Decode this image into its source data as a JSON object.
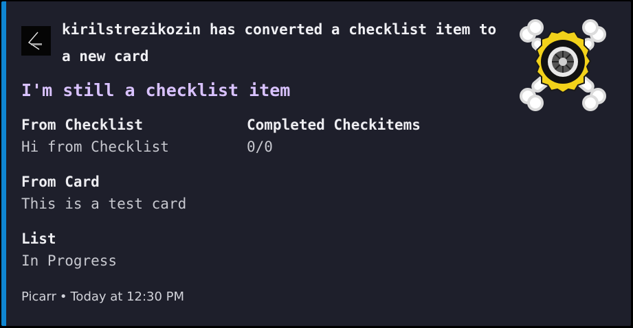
{
  "embed": {
    "accent_color": "#0f86d2",
    "author": {
      "avatar_icon": "kirilstrezikozin-avatar",
      "text": "kirilstrezikozin has converted a checklist item to a new card"
    },
    "title": "I'm still a checklist item",
    "thumbnail_icon": "gear-crossbones-logo",
    "fields": [
      {
        "name": "From Checklist",
        "value": "Hi from Checklist"
      },
      {
        "name": "Completed Checkitems",
        "value": "0/0"
      },
      {
        "name": "From Card",
        "value": "This is a test card"
      },
      {
        "name": "List",
        "value": "In Progress"
      }
    ],
    "footer": {
      "app": "Picarr",
      "separator": "•",
      "timestamp": "Today at 12:30 PM"
    }
  }
}
